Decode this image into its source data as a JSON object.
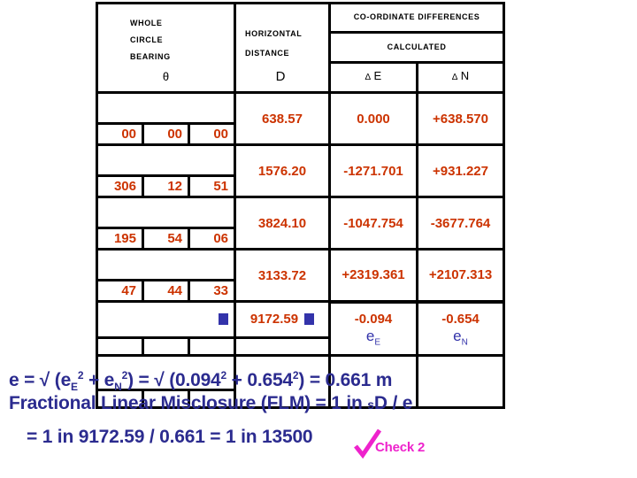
{
  "table": {
    "headers": {
      "bearing": {
        "line1": "WHOLE",
        "line2": "CIRCLE",
        "line3": "BEARING",
        "symbol": "θ"
      },
      "distance": {
        "line1": "HORIZONTAL",
        "line2": "DISTANCE",
        "symbol": "D"
      },
      "coordinate_differences": "CO-ORDINATE DIFFERENCES",
      "calculated": "CALCULATED",
      "delta_e": {
        "delta": "∆",
        "label": "E"
      },
      "delta_n": {
        "delta": "∆",
        "label": "N"
      }
    },
    "rows": [
      {
        "bearing": {
          "deg": "00",
          "min": "00",
          "sec": "00"
        },
        "distance": "638.57",
        "delta_e": "0.000",
        "delta_n": "+638.570"
      },
      {
        "bearing": {
          "deg": "306",
          "min": "12",
          "sec": "51"
        },
        "distance": "1576.20",
        "delta_e": "-1271.701",
        "delta_n": "+931.227"
      },
      {
        "bearing": {
          "deg": "195",
          "min": "54",
          "sec": "06"
        },
        "distance": "3824.10",
        "delta_e": "-1047.754",
        "delta_n": "-3677.764"
      },
      {
        "bearing": {
          "deg": "47",
          "min": "44",
          "sec": "33"
        },
        "distance": "3133.72",
        "delta_e": "+2319.361",
        "delta_n": "+2107.313"
      }
    ],
    "totals": {
      "distance": "9172.59",
      "delta_e_value": "-0.094",
      "delta_e_label": "e",
      "delta_e_sub": "E",
      "delta_n_value": "-0.654",
      "delta_n_label": "e",
      "delta_n_sub": "N"
    }
  },
  "formula": {
    "line1": {
      "pre": "e = √ (e",
      "sub1": "E",
      "sup1": "2",
      "mid1": " + e",
      "sub2": "N",
      "sup2": "2",
      "mid2": ") = √ (0.094",
      "sup3": "2",
      "mid3": " + 0.654",
      "sup4": "2",
      "post": ") = 0.661 m"
    },
    "line2": {
      "text_a": "Fractional Linear Misclosure (FLM)  =  1 in ",
      "text_s": "s",
      "text_b": "D / e"
    },
    "line3": "= 1 in 9172.59 / 0.661 = 1 in 13500"
  },
  "check": {
    "label": "Check 2",
    "color": "#ee22cc"
  },
  "colors": {
    "value_red": "#cc3300",
    "formula_blue": "#2b2b8f",
    "marker_blue": "#3333aa",
    "check_magenta": "#ee22cc",
    "border_black": "#000000"
  }
}
